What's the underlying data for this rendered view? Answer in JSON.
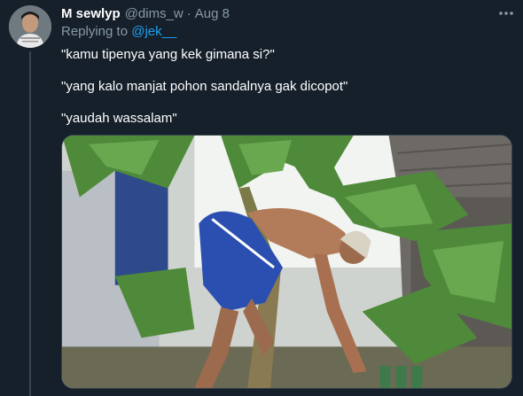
{
  "tweet": {
    "display_name": "M sewlyp",
    "handle": "@dims_w",
    "separator": "·",
    "date": "Aug 8",
    "replying_to_prefix": "Replying to",
    "replying_to_handle": "@jek__",
    "lines": [
      "\"kamu tipenya yang kek gimana si?\"",
      "\"yang kalo manjat pohon sandalnya gak dicopot\"",
      "\"yaudah wassalam\""
    ],
    "media": {
      "description_icon": "photo-image"
    }
  },
  "colors": {
    "background": "#15202b",
    "primary_text": "#ffffff",
    "secondary_text": "#8899a6",
    "accent": "#1da1f2",
    "border": "#38444d"
  },
  "icons": {
    "more": "more-horizontal-icon"
  }
}
